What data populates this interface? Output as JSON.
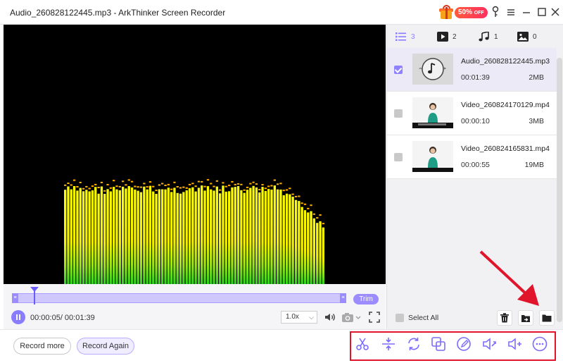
{
  "window": {
    "title": "Audio_260828122445.mp3   -   ArkThinker Screen Recorder",
    "promo_badge": "50%",
    "promo_badge_suffix": "OFF"
  },
  "tabs": [
    {
      "icon": "list-icon",
      "count": "3"
    },
    {
      "icon": "video-icon",
      "count": "2"
    },
    {
      "icon": "music-icon",
      "count": "1"
    },
    {
      "icon": "image-icon",
      "count": "0"
    }
  ],
  "recordings": [
    {
      "name": "Audio_260828122445.mp3",
      "duration": "00:01:39",
      "size": "2MB",
      "checked": true,
      "type": "audio"
    },
    {
      "name": "Video_260824170129.mp4",
      "duration": "00:00:10",
      "size": "3MB",
      "checked": false,
      "type": "video"
    },
    {
      "name": "Video_260824165831.mp4",
      "duration": "00:00:55",
      "size": "19MB",
      "checked": false,
      "type": "video"
    }
  ],
  "side_actions": {
    "select_all": "Select All",
    "buttons": [
      "trash-icon",
      "export-icon",
      "folder-icon"
    ]
  },
  "player": {
    "time": "00:00:05/ 00:01:39",
    "speed": "1.0x",
    "trim_label": "Trim",
    "progress": 0.05
  },
  "bottom": {
    "record_more": "Record more",
    "record_again": "Record Again",
    "tools": [
      "scissors-icon",
      "split-icon",
      "rotate-icon",
      "compress-icon",
      "edit-metadata-icon",
      "volume-boost-icon",
      "volume-add-icon",
      "more-icon"
    ]
  },
  "colors": {
    "accent": "#8a7cff",
    "highlight_box": "#e0142a",
    "arrow": "#e0142a"
  }
}
